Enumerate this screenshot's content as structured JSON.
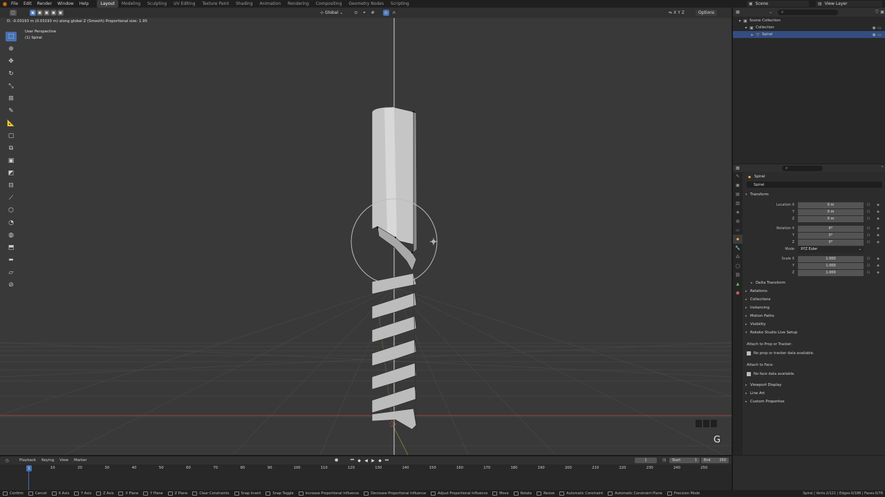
{
  "menu": {
    "items": [
      "File",
      "Edit",
      "Render",
      "Window",
      "Help"
    ],
    "workspaces": [
      "Layout",
      "Modeling",
      "Sculpting",
      "UV Editing",
      "Texture Paint",
      "Shading",
      "Animation",
      "Rendering",
      "Compositing",
      "Geometry Nodes",
      "Scripting"
    ],
    "active_workspace": "Layout",
    "scene": "Scene",
    "view_layer": "View Layer"
  },
  "viewport": {
    "header_status": "D: -0.03193 m (0.03193 m) along global Z (Smooth)   Proportional size: 1.95",
    "transform_orientation": "Global",
    "options_label": "Options",
    "axes_labels": [
      "X",
      "Y",
      "Z"
    ],
    "perspective": "User Perspective",
    "object_name": "(1) Spiral",
    "key_overlay": "G",
    "accent_color": "#4772b3",
    "grid_color": "#484848",
    "x_axis_color": "#a34444",
    "y_axis_color": "#7a9637"
  },
  "toolbar": {
    "tools": [
      "select-box-icon",
      "cursor-icon",
      "move-icon",
      "rotate-icon",
      "scale-icon",
      "transform-icon",
      "annotate-icon",
      "measure-icon",
      "add-cube-icon",
      "extrude-icon",
      "inset-icon",
      "bevel-icon",
      "loop-cut-icon",
      "knife-icon",
      "poly-build-icon",
      "spin-icon",
      "smooth-icon",
      "edge-slide-icon",
      "shrink-fatten-icon",
      "shear-icon",
      "rip-icon"
    ],
    "active_index": 0
  },
  "outliner": {
    "rows": [
      {
        "label": "Scene Collection",
        "indent": 0,
        "icon": "collection-icon",
        "selected": false
      },
      {
        "label": "Collection",
        "indent": 1,
        "icon": "collection-icon",
        "selected": false
      },
      {
        "label": "Spiral",
        "indent": 2,
        "icon": "mesh-icon",
        "selected": true
      }
    ]
  },
  "properties": {
    "object_title": "Spiral",
    "object_name_field": "Spiral",
    "transform_header": "Transform",
    "location": {
      "label_x": "Location X",
      "label_y": "Y",
      "label_z": "Z",
      "x": "0 m",
      "y": "0 m",
      "z": "0 m"
    },
    "rotation": {
      "label_x": "Rotation X",
      "label_y": "Y",
      "label_z": "Z",
      "x": "0°",
      "y": "0°",
      "z": "0°"
    },
    "mode": {
      "label": "Mode",
      "value": "XYZ Euler"
    },
    "scale": {
      "label_x": "Scale X",
      "label_y": "Y",
      "label_z": "Z",
      "x": "1.000",
      "y": "1.000",
      "z": "1.000"
    },
    "delta_transform": "Delta Transform",
    "panels": [
      "Relations",
      "Collections",
      "Instancing",
      "Motion Paths",
      "Visibility"
    ],
    "rokoko_header": "Rokoko Studio Live Setup",
    "attach_prop_label": "Attach to Prop or Tracker:",
    "attach_prop_note": "No prop or tracker data available.",
    "attach_face_label": "Attach to Face:",
    "attach_face_note": "No face data available.",
    "panels_after": [
      "Viewport Display",
      "Line Art",
      "Custom Properties"
    ]
  },
  "timeline": {
    "menus": [
      "Playback",
      "Keying",
      "View",
      "Marker"
    ],
    "current_frame": "1",
    "start_label": "Start",
    "start": "1",
    "end_label": "End",
    "end": "250",
    "ticks": [
      "10",
      "20",
      "30",
      "40",
      "50",
      "60",
      "70",
      "80",
      "90",
      "100",
      "110",
      "120",
      "130",
      "140",
      "150",
      "160",
      "170",
      "180",
      "190",
      "200",
      "210",
      "220",
      "230",
      "240",
      "250"
    ],
    "playhead_frame": "1"
  },
  "statusbar": {
    "items": [
      "Confirm",
      "Cancel",
      "X Axis",
      "Y Axis",
      "Z Axis",
      "X Plane",
      "Y Plane",
      "Z Plane",
      "Clear Constraints",
      "Snap Invert",
      "Snap Toggle",
      "Increase Proportional Influence",
      "Decrease Proportional Influence",
      "Adjust Proportional Influence",
      "Move",
      "Rotate",
      "Resize",
      "Automatic Constraint",
      "Automatic Constraint Plane",
      "Precision Mode"
    ],
    "stats": "Spiral | Verts:2/121 | Edges:0/186 | Faces:0/76"
  }
}
